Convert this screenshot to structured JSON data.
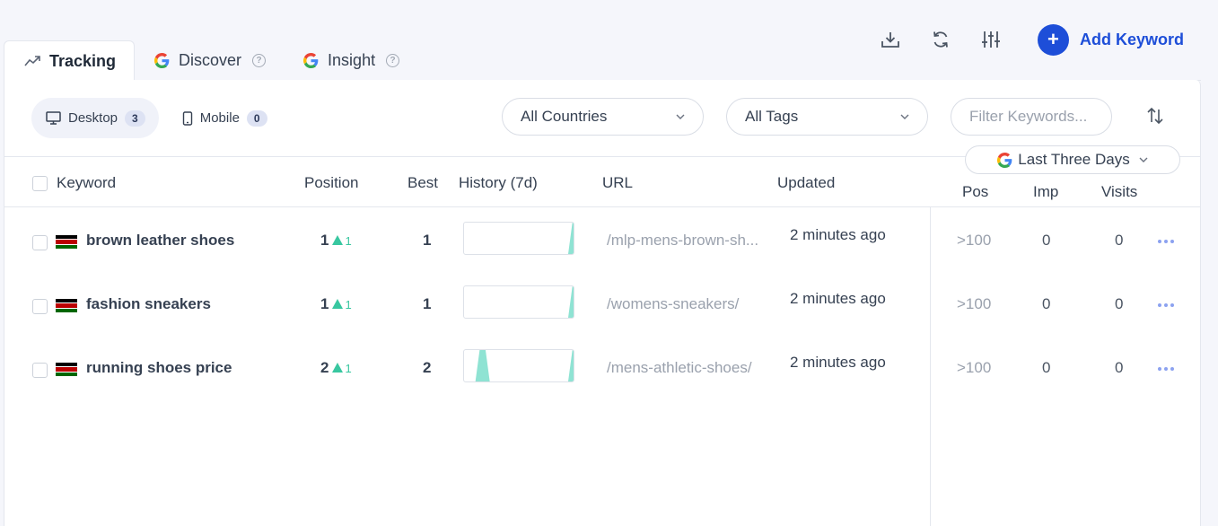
{
  "tabs": [
    {
      "label": "Tracking",
      "icon": "trend-up-icon",
      "active": true
    },
    {
      "label": "Discover",
      "icon": "google-icon",
      "help": "?"
    },
    {
      "label": "Insight",
      "icon": "google-icon",
      "help": "?"
    }
  ],
  "actions": {
    "add_keyword_label": "Add Keyword",
    "add_symbol": "+"
  },
  "devices": {
    "desktop": {
      "label": "Desktop",
      "count": "3"
    },
    "mobile": {
      "label": "Mobile",
      "count": "0"
    }
  },
  "filters": {
    "countries": "All Countries",
    "tags": "All Tags",
    "keyword_placeholder": "Filter Keywords...",
    "date_range": "Last Three Days"
  },
  "columns": {
    "keyword": "Keyword",
    "position": "Position",
    "best": "Best",
    "history": "History (7d)",
    "url": "URL",
    "updated": "Updated",
    "pos": "Pos",
    "imp": "Imp",
    "visits": "Visits"
  },
  "rows": [
    {
      "keyword": "brown leather shoes",
      "position": "1",
      "change": "1",
      "best": "1",
      "url": "/mlp-mens-brown-sh...",
      "updated": "2 minutes ago",
      "gpos": ">100",
      "imp": "0",
      "visits": "0",
      "history": [
        0,
        0,
        0,
        0,
        0,
        0,
        1
      ]
    },
    {
      "keyword": "fashion sneakers",
      "position": "1",
      "change": "1",
      "best": "1",
      "url": "/womens-sneakers/",
      "updated": "2 minutes ago",
      "gpos": ">100",
      "imp": "0",
      "visits": "0",
      "history": [
        0,
        0,
        0,
        0,
        0,
        0,
        1
      ]
    },
    {
      "keyword": "running shoes price",
      "position": "2",
      "change": "1",
      "best": "2",
      "url": "/mens-athletic-shoes/",
      "updated": "2 minutes ago",
      "gpos": ">100",
      "imp": "0",
      "visits": "0",
      "history": [
        0,
        1,
        0,
        0,
        0,
        0,
        1
      ]
    }
  ],
  "colors": {
    "accent": "#1d4ed8",
    "positive": "#38c7a0",
    "spark_fill": "#8fe3d3"
  }
}
